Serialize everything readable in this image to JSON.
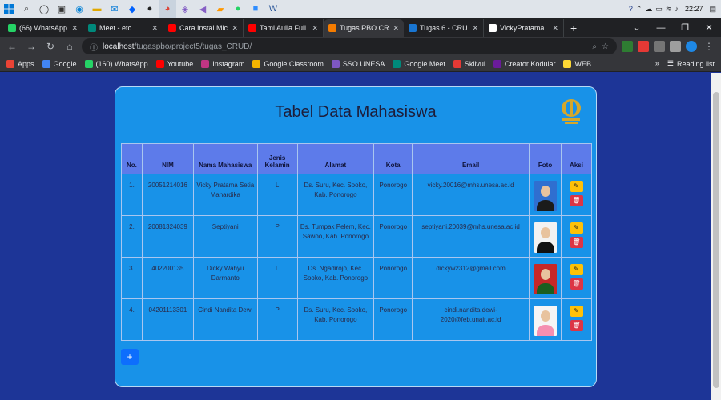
{
  "taskbar": {
    "clock": "22:27",
    "icons": [
      "windows-icon",
      "search-icon",
      "cortana-icon",
      "task-view-icon",
      "edge-icon",
      "file-explorer-icon",
      "mail-icon",
      "dropbox-icon",
      "app-icon",
      "chrome-icon",
      "game-icon",
      "visual-studio-icon",
      "sublime-icon",
      "whatsapp-icon",
      "zoom-icon",
      "word-icon"
    ]
  },
  "tabs": [
    {
      "title": "(66) WhatsApp",
      "color": "#25d366"
    },
    {
      "title": "Meet - etc",
      "color": "#00897b"
    },
    {
      "title": "Cara Instal Mic",
      "color": "#ff0000"
    },
    {
      "title": "Tami Aulia Full",
      "color": "#ff0000"
    },
    {
      "title": "Tugas PBO CRU",
      "color": "#f57c00",
      "active": true
    },
    {
      "title": "Tugas 6 - CRU",
      "color": "#1976d2"
    },
    {
      "title": "VickyPratama",
      "color": "#ffffff"
    }
  ],
  "address": {
    "host": "localhost",
    "path": "/tugaspbo/project5/tugas_CRUD/"
  },
  "bookmarks": {
    "items": [
      {
        "label": "Apps",
        "color": "#ea4335"
      },
      {
        "label": "Google",
        "color": "#4285f4"
      },
      {
        "label": "(160) WhatsApp",
        "color": "#25d366"
      },
      {
        "label": "Youtube",
        "color": "#ff0000"
      },
      {
        "label": "Instagram",
        "color": "#c13584"
      },
      {
        "label": "Google Classroom",
        "color": "#f4b400"
      },
      {
        "label": "SSO UNESA",
        "color": "#7e57c2"
      },
      {
        "label": "Google Meet",
        "color": "#00897b"
      },
      {
        "label": "Skilvul",
        "color": "#e53935"
      },
      {
        "label": "Creator Kodular",
        "color": "#6a1b9a"
      },
      {
        "label": "WEB",
        "color": "#fdd835"
      }
    ],
    "more": "»",
    "reading_list": "Reading list"
  },
  "page": {
    "title": "Tabel Data Mahasiswa",
    "headers": [
      "No.",
      "NIM",
      "Nama Mahasiswa",
      "Jenis Kelamin",
      "Alamat",
      "Kota",
      "Email",
      "Foto",
      "Aksi"
    ],
    "rows": [
      {
        "no": "1.",
        "nim": "20051214016",
        "nama": "Vicky Pratama Setia Mahardika",
        "jk": "L",
        "alamat": "Ds. Suru, Kec. Sooko, Kab. Ponorogo",
        "kota": "Ponorogo",
        "email": "vicky.20016@mhs.unesa.ac.id",
        "photo_bg": "#2f6fd0",
        "photo_body": "#1b1b1b"
      },
      {
        "no": "2.",
        "nim": "20081324039",
        "nama": "Septiyani",
        "jk": "P",
        "alamat": "Ds. Tumpak Pelem, Kec. Sawoo, Kab. Ponorogo",
        "kota": "Ponorogo",
        "email": "septiyani.20039@mhs.unesa.ac.id",
        "photo_bg": "#f2f2f2",
        "photo_body": "#111111"
      },
      {
        "no": "3.",
        "nim": "402200135",
        "nama": "Dicky Wahyu Darmanto",
        "jk": "L",
        "alamat": "Ds. Ngadirojo, Kec. Sooko, Kab. Ponorogo",
        "kota": "Ponorogo",
        "email": "dickyw2312@gmail.com",
        "photo_bg": "#c62828",
        "photo_body": "#1b5e20"
      },
      {
        "no": "4.",
        "nim": "04201113301",
        "nama": "Cindi Nandita Dewi",
        "jk": "P",
        "alamat": "Ds. Suru, Kec. Sooko, Kab. Ponorogo",
        "kota": "Ponorogo",
        "email": "cindi.nandita.dewi-2020@feb.unair.ac.id",
        "photo_bg": "#f5f5f5",
        "photo_body": "#f48fb1"
      }
    ],
    "add_label": "+"
  }
}
